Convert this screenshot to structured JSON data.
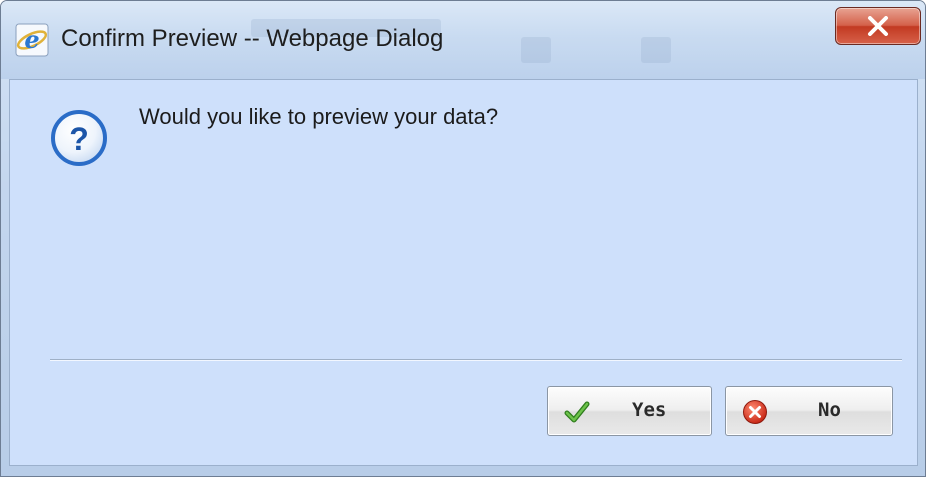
{
  "window": {
    "title": "Confirm Preview -- Webpage Dialog",
    "app_icon": "internet-explorer-icon",
    "close_icon": "close-icon"
  },
  "dialog": {
    "icon": "question-icon",
    "message": "Would you like to preview your data?"
  },
  "buttons": {
    "yes": {
      "label": "Yes",
      "icon": "checkmark-icon"
    },
    "no": {
      "label": "No",
      "icon": "cancel-x-icon"
    }
  },
  "colors": {
    "client_background": "#cee0fb",
    "close_button": "#c9452d",
    "question_icon": "#2a6cc7",
    "checkmark": "#3f9b2c",
    "cancel": "#d8331f"
  }
}
